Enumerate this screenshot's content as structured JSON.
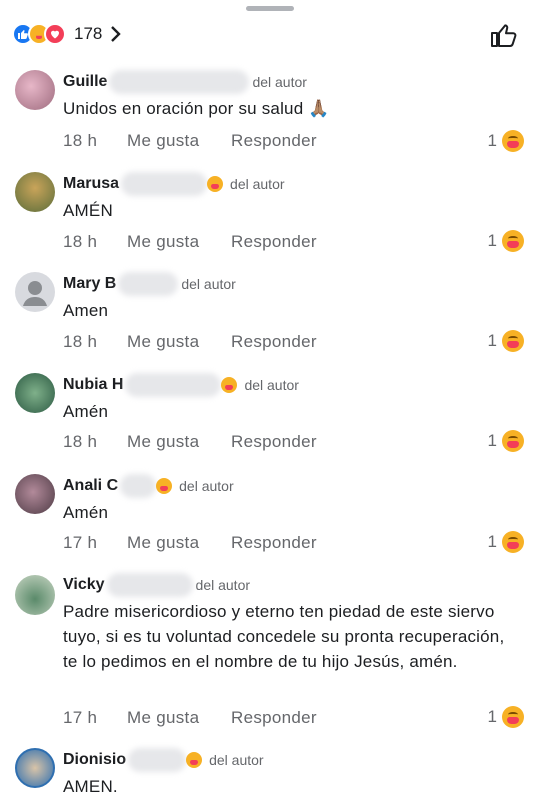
{
  "reactions": {
    "count": "178",
    "icons": [
      "like-icon",
      "care-icon",
      "love-icon"
    ],
    "colors": {
      "like": "#1877f2",
      "care": "#f7b125",
      "love": "#f33e58"
    }
  },
  "author_badge": "del autor",
  "actions": {
    "like": "Me gusta",
    "reply": "Responder"
  },
  "comments": [
    {
      "name": "Guille",
      "text": "Unidos en oración por su salud 🙏🏽",
      "time": "18 h",
      "count": "1"
    },
    {
      "name": "Marusa",
      "text": "AMÉN",
      "time": "18 h",
      "count": "1"
    },
    {
      "name": "Mary B",
      "text": "Amen",
      "time": "18 h",
      "count": "1"
    },
    {
      "name": "Nubia H",
      "text": "Amén",
      "time": "18 h",
      "count": "1"
    },
    {
      "name": "Anali C",
      "text": "Amén",
      "time": "17 h",
      "count": "1"
    },
    {
      "name": "Vicky",
      "text": "Padre misericordioso y eterno ten piedad de este siervo tuyo, si es tu voluntad concedele su pronta recuperación, te lo  pedimos en el nombre de tu hijo Jesús, amén.",
      "time": "17 h",
      "count": "1"
    },
    {
      "name": "Dionisio",
      "text": "AMEN.",
      "time": "",
      "count": ""
    }
  ]
}
